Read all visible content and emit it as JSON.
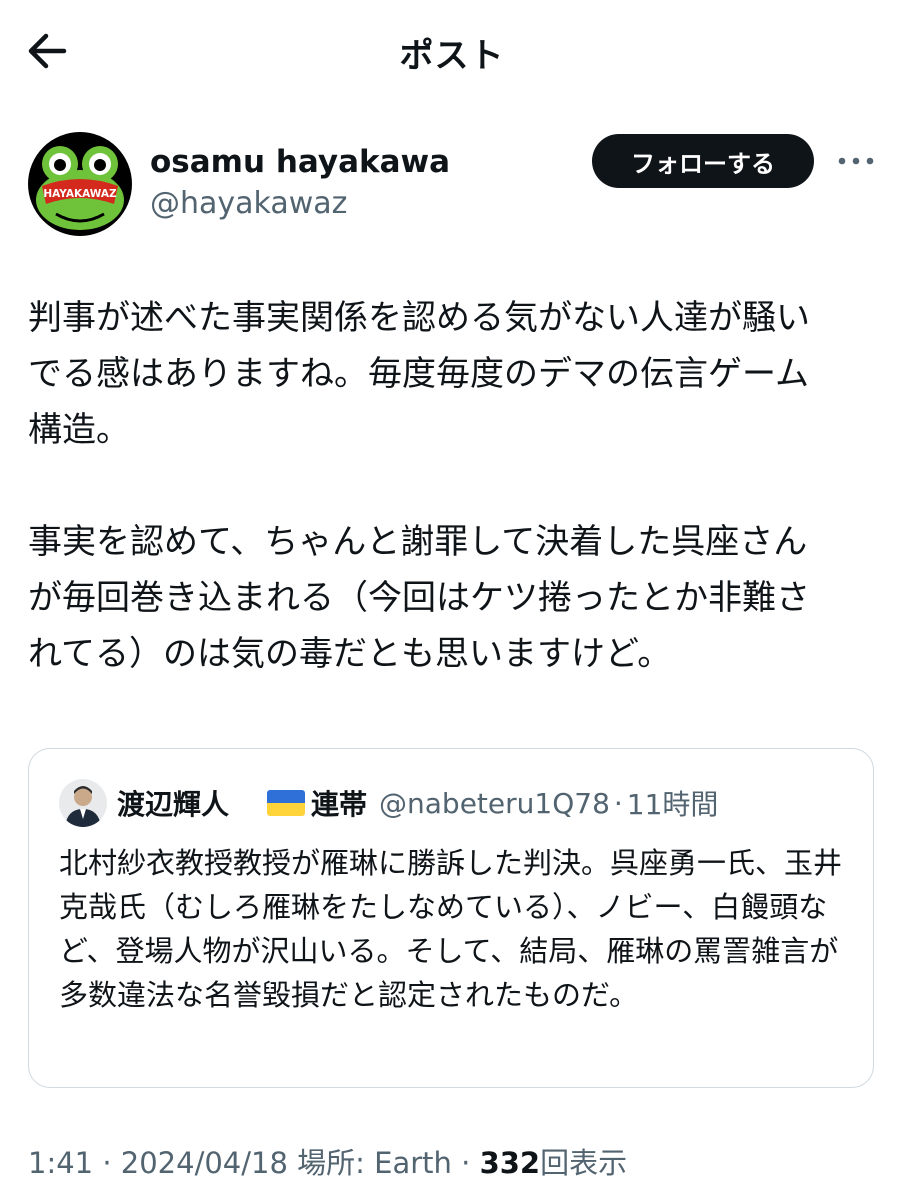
{
  "header": {
    "title": "ポスト"
  },
  "author": {
    "display_name": "osamu hayakawa",
    "handle": "@hayakawaz",
    "avatar_text": "HAYAKAWAZ"
  },
  "follow_button": {
    "label": "フォローする"
  },
  "post": {
    "paragraphs": [
      "判事が述べた事実関係を認める気がない人達が騒い\nでる感はありますね。毎度毎度のデマの伝言ゲーム\n構造。",
      "事実を認めて、ちゃんと謝罪して決着した呉座さん\nが毎回巻き込まれる（今回はケツ捲ったとか非難さ\nれてる）のは気の毒だとも思いますけど。"
    ]
  },
  "quote": {
    "name": "渡辺輝人",
    "flag_icon": "ukraine-flag-icon",
    "tag": "連帯",
    "handle": "@nabeteru1Q78",
    "separator": "·",
    "time": "11時間",
    "text": "北村紗衣教授教授が雁琳に勝訴した判決。呉座勇一氏、玉井克哉氏（むしろ雁琳をたしなめている）、ノビー、白饅頭など、登場人物が沢山いる。そして、結局、雁琳の罵詈雑言が多数違法な名誉毀損だと認定されたものだ。"
  },
  "meta": {
    "time": "1:41",
    "sep1": " · ",
    "date": "2024/04/18",
    "location": "場所: Earth",
    "sep2": " · ",
    "views_count": "332",
    "views_label": "回表示"
  },
  "colors": {
    "text_primary": "#0f1419",
    "text_secondary": "#536471",
    "border": "#cfd9de",
    "button_bg": "#0f1419",
    "avatar_bg": "#000000",
    "avatar_frog": "#6fc33a",
    "avatar_banner": "#d42a1e"
  }
}
